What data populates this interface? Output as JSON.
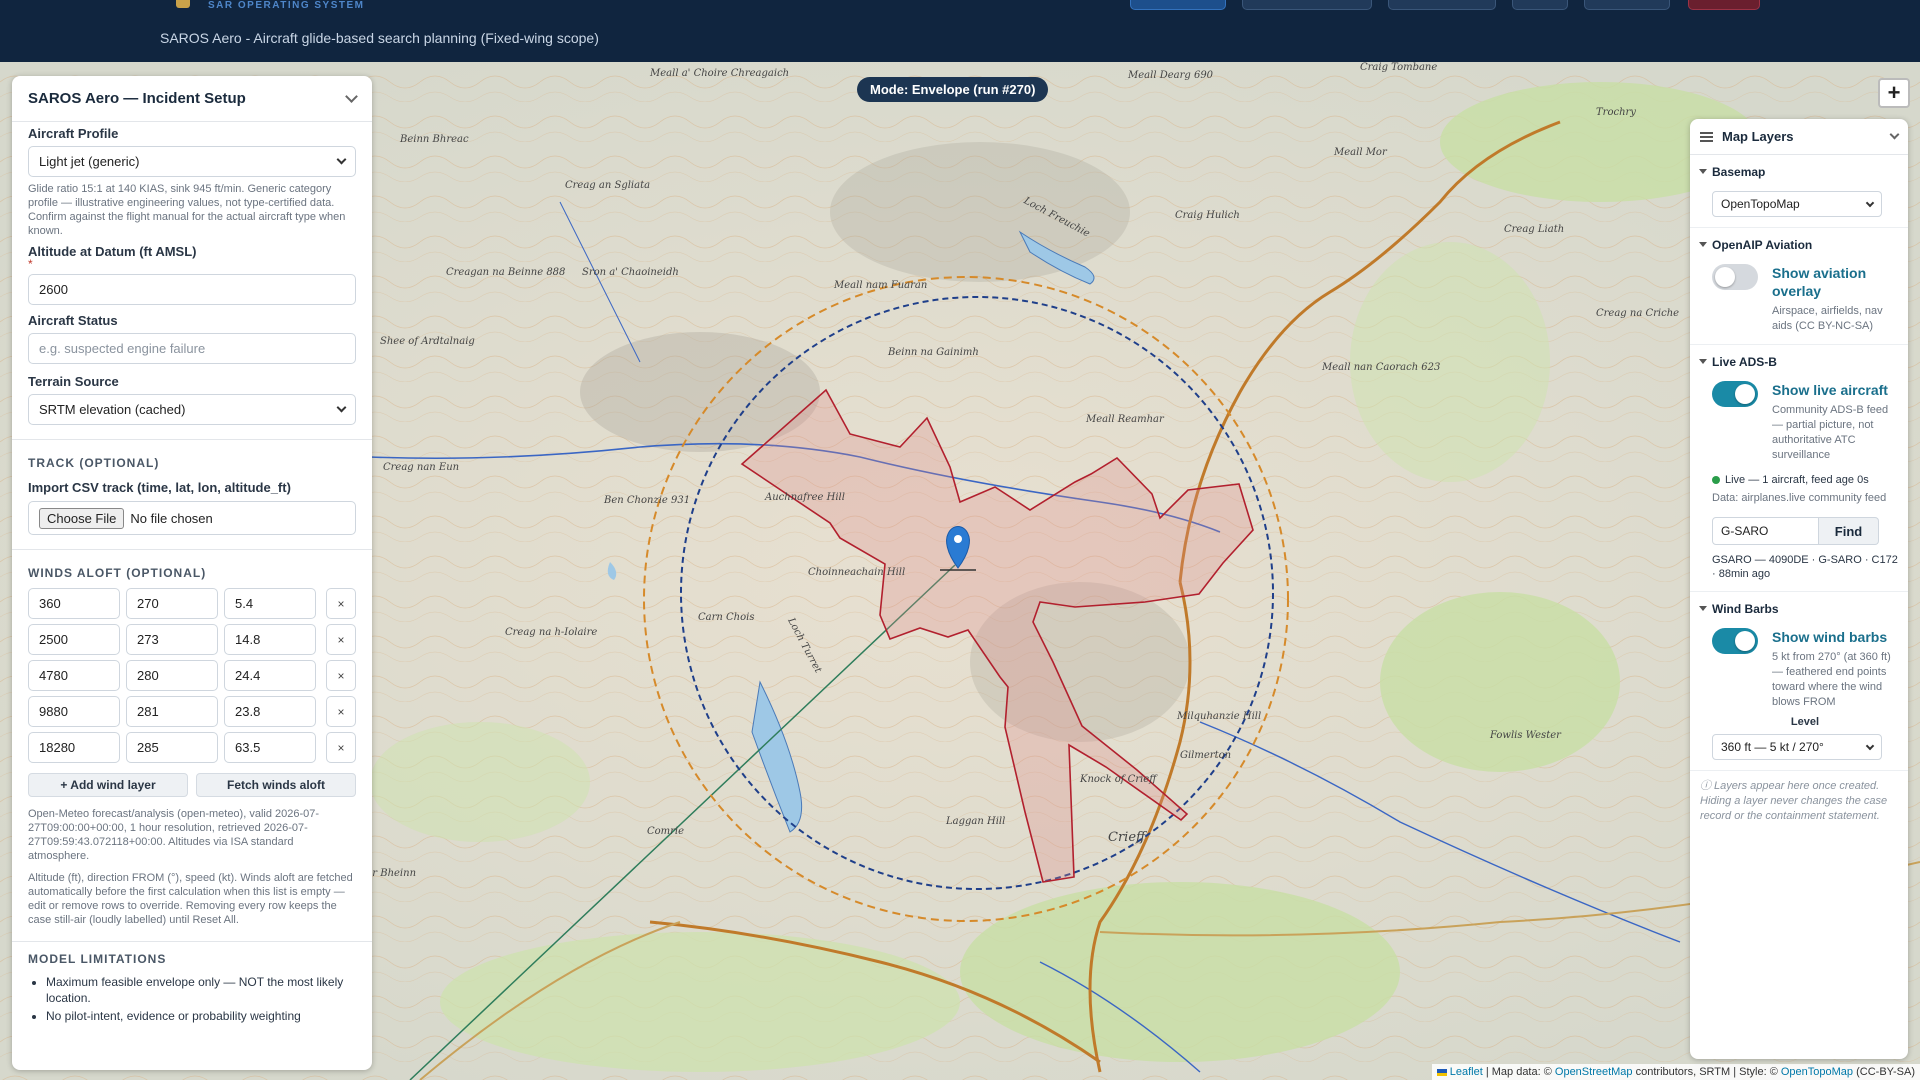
{
  "header": {
    "brand_sub": "SAR OPERATING SYSTEM",
    "subtitle": "SAROS Aero - Aircraft glide-based search planning (Fixed-wing scope)"
  },
  "map": {
    "mode_badge": "Mode: Envelope (run #270)",
    "zoom_in": "+",
    "places": [
      "Meall a' Choire Chreagaich",
      "Beinn Bhreac",
      "Creag an Sgliata",
      "Meall Dearg 690",
      "Craig Tombane",
      "Trochry",
      "Meall Mor",
      "Craig Hulich",
      "Creag Liath",
      "Creagan na Beinne 888",
      "Sron a' Chaoineidh",
      "Meall nam Fuaran",
      "Shee of Ardtalnaig",
      "Beinn na Gainimh",
      "Meall Reamhar",
      "Meall nan Caorach 623",
      "Creag na Criche",
      "Creag nan Eun",
      "Ben Chonzie 931",
      "Auchnafree Hill",
      "Choinneachain Hill",
      "Carn Chois",
      "Loch Turret",
      "Creag na h-Iolaire",
      "Milquhanzie Hill",
      "Fowlis Wester",
      "Gilmerton",
      "Knock of Crieff",
      "Laggan Hill",
      "Comrie",
      "Crieff",
      "Mor Bheinn",
      "Loch Freuchie"
    ],
    "attribution": {
      "leaflet": "Leaflet",
      "text1": "| Map data: ©",
      "osm": "OpenStreetMap",
      "text2": "contributors, SRTM | Style: ©",
      "otm": "OpenTopoMap",
      "text3": "(CC-BY-SA)"
    },
    "colors": {
      "envelope": "#c0392b",
      "ring_outer": "#d68a2a",
      "ring_inner": "#1f3f8a",
      "track": "#2e7d5b",
      "marker": "#2a7bd3"
    }
  },
  "left_panel": {
    "title": "SAROS Aero — Incident Setup",
    "aircraft_profile_label": "Aircraft Profile",
    "aircraft_profile_value": "Light jet (generic)",
    "aircraft_profile_note": "Glide ratio 15:1 at 140 KIAS, sink 945 ft/min. Generic category profile — illustrative engineering values, not type-certified data. Confirm against the flight manual for the actual aircraft type when known.",
    "altitude_label": "Altitude at Datum (ft AMSL)",
    "altitude_required": "*",
    "altitude_value": "2600",
    "status_label": "Aircraft Status",
    "status_placeholder": "e.g. suspected engine failure",
    "terrain_label": "Terrain Source",
    "terrain_value": "SRTM elevation (cached)",
    "track_head": "TRACK (OPTIONAL)",
    "import_label": "Import CSV track (time, lat, lon, altitude_ft)",
    "choose_file": "Choose File",
    "no_file": "No file chosen",
    "winds_head": "WINDS ALOFT (OPTIONAL)",
    "winds": [
      {
        "alt": "360",
        "dir": "270",
        "spd": "5.4",
        "remove": "×"
      },
      {
        "alt": "2500",
        "dir": "273",
        "spd": "14.8",
        "remove": "×"
      },
      {
        "alt": "4780",
        "dir": "280",
        "spd": "24.4",
        "remove": "×"
      },
      {
        "alt": "9880",
        "dir": "281",
        "spd": "23.8",
        "remove": "×"
      },
      {
        "alt": "18280",
        "dir": "285",
        "spd": "63.5",
        "remove": "×"
      }
    ],
    "add_wind": "+ Add wind layer",
    "fetch_winds": "Fetch winds aloft",
    "winds_note1": "Open-Meteo forecast/analysis (open-meteo), valid 2026-07-27T09:00:00+00:00, 1 hour resolution, retrieved 2026-07-27T09:59:43.072118+00:00. Altitudes via ISA standard atmosphere.",
    "winds_note2": "Altitude (ft), direction FROM (°), speed (kt). Winds aloft are fetched automatically before the first calculation when this list is empty — edit or remove rows to override. Removing every row keeps the case still-air (loudly labelled) until Reset All.",
    "limits_head": "MODEL LIMITATIONS",
    "limits": [
      "Maximum feasible envelope only — NOT the most likely location.",
      "No pilot-intent, evidence or probability weighting"
    ]
  },
  "right_panel": {
    "title": "Map Layers",
    "basemap_title": "Basemap",
    "basemap_value": "OpenTopoMap",
    "openaip_title": "OpenAIP Aviation",
    "aviation_label": "Show aviation overlay",
    "aviation_desc": "Airspace, airfields, nav aids (CC BY-NC-SA)",
    "aviation_on": false,
    "adsb_title": "Live ADS-B",
    "adsb_label": "Show live aircraft",
    "adsb_desc": "Community ADS-B feed — partial picture, not authoritative ATC surveillance",
    "adsb_on": true,
    "adsb_status": "Live — 1 aircraft, feed age 0s",
    "adsb_source": "Data: airplanes.live community feed",
    "find_value": "G-SARO",
    "find_button": "Find",
    "find_result": "GSARO — 4090DE · G-SARO · C172 · 88min ago",
    "barbs_title": "Wind Barbs",
    "barbs_label": "Show wind barbs",
    "barbs_desc": "5 kt from 270° (at 360 ft) — feathered end points toward where the wind blows FROM",
    "barbs_on": true,
    "level_label": "Level",
    "level_value": "360 ft — 5 kt / 270°",
    "footer": "ⓘ Layers appear here once created. Hiding a layer never changes the case record or the containment statement."
  }
}
